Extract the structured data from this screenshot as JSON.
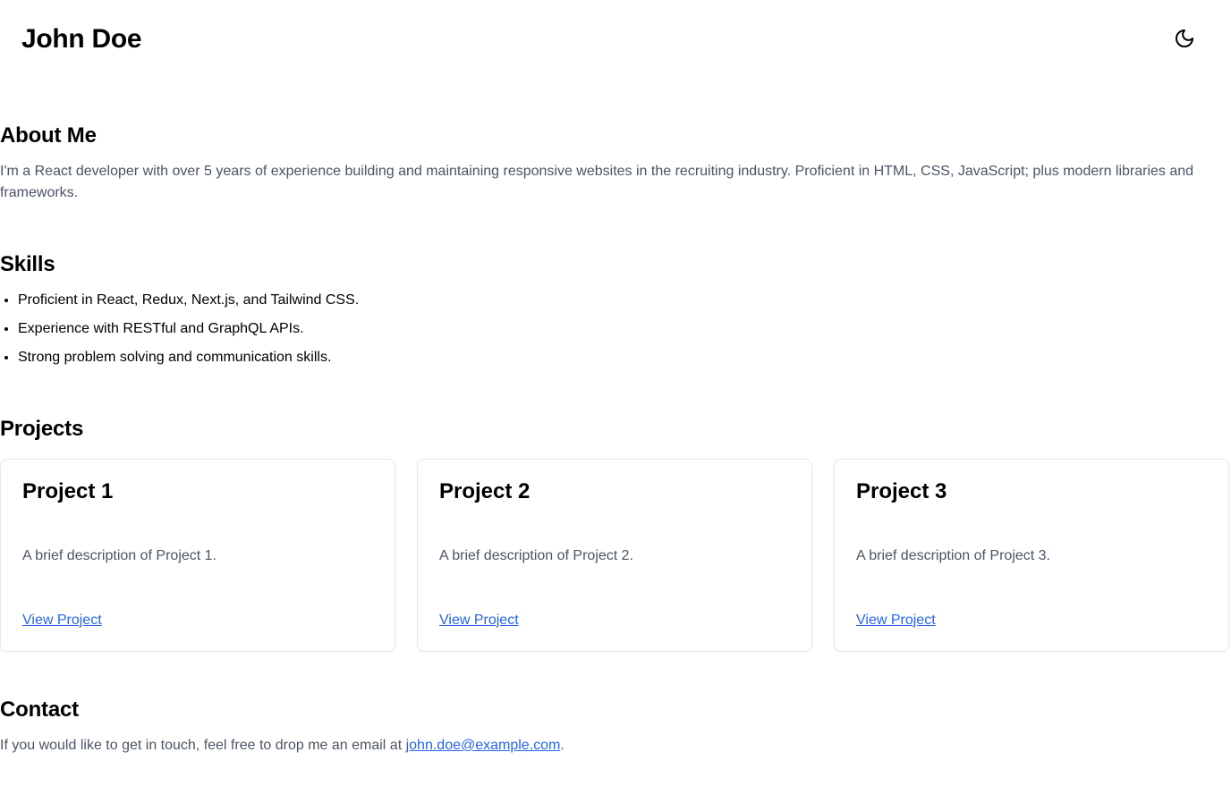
{
  "header": {
    "title": "John Doe",
    "theme_toggle_icon": "moon-icon"
  },
  "about": {
    "heading": "About Me",
    "text": "I'm a React developer with over 5 years of experience building and maintaining responsive websites in the recruiting industry. Proficient in HTML, CSS, JavaScript; plus modern libraries and frameworks."
  },
  "skills": {
    "heading": "Skills",
    "items": [
      "Proficient in React, Redux, Next.js, and Tailwind CSS.",
      "Experience with RESTful and GraphQL APIs.",
      "Strong problem solving and communication skills."
    ]
  },
  "projects": {
    "heading": "Projects",
    "items": [
      {
        "title": "Project 1",
        "description": "A brief description of Project 1.",
        "link_label": "View Project"
      },
      {
        "title": "Project 2",
        "description": "A brief description of Project 2.",
        "link_label": "View Project"
      },
      {
        "title": "Project 3",
        "description": "A brief description of Project 3.",
        "link_label": "View Project"
      }
    ]
  },
  "contact": {
    "heading": "Contact",
    "text_before": "If you would like to get in touch, feel free to drop me an email at ",
    "email": "john.doe@example.com",
    "text_after": "."
  },
  "colors": {
    "link": "#2563eb",
    "muted_text": "#4b5563",
    "card_border": "#e5e7eb"
  }
}
